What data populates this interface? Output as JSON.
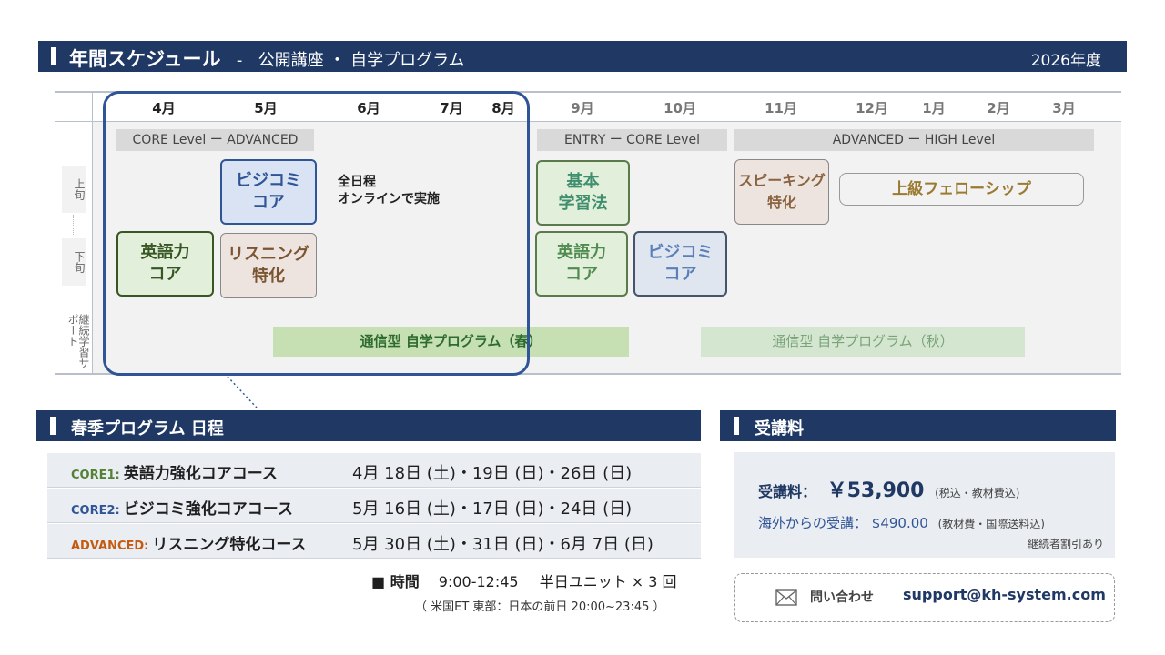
{
  "header": {
    "title": "年間スケジュール",
    "separator": "-",
    "subtitle": "公開講座 ・ 自学プログラム",
    "year": "2026年度"
  },
  "months": [
    "4月",
    "5月",
    "6月",
    "7月",
    "8月",
    "9月",
    "10月",
    "11月",
    "12月",
    "1月",
    "2月",
    "3月"
  ],
  "row_labels": {
    "upper": "上旬",
    "lower": "下旬",
    "support": "継続学習サポート"
  },
  "levels": {
    "spring": "CORE Level ー ADVANCED",
    "fall_entry": "ENTRY ー CORE Level",
    "fall_advanced": "ADVANCED ー HIGH Level"
  },
  "courses": {
    "bizcomi_core": "ビジコミ\nコア",
    "eigo_core": "英語力\nコア",
    "listening": "リスニング\n特化",
    "kihon": "基本\n学習法",
    "eigo_core_fall": "英語力\nコア",
    "bizcomi_core_fall": "ビジコミ\nコア",
    "speaking": "スピーキング\n特化",
    "fellowship": "上級フェローシップ"
  },
  "note_full_day": "全日程\nオンラインで実施",
  "correspondence": {
    "spring": "通信型 自学プログラム（春）",
    "fall": "通信型 自学プログラム（秋）"
  },
  "spring_section": {
    "title": "春季プログラム 日程",
    "rows": [
      {
        "tag": "CORE1:",
        "name": "英語力強化コアコース",
        "dates": "4月 18日 (土)・19日 (日)・26日 (日)",
        "tag_color": "#548235"
      },
      {
        "tag": "CORE2:",
        "name": "ビジコミ強化コアコース",
        "dates": "5月 16日 (土)・17日 (日)・24日 (日)",
        "tag_color": "#2f5597"
      },
      {
        "tag": "ADVANCED:",
        "name": "リスニング特化コース",
        "dates": "5月 30日 (土)・31日 (日)・6月 7日 (日)",
        "tag_color": "#c55a11"
      }
    ],
    "time_label": "■ 時間",
    "time_value": "9:00-12:45",
    "time_unit": "半日ユニット × 3 回",
    "time_note": "（ 米国ET 東部：日本の前日 20:00~23:45 ）"
  },
  "fee_section": {
    "title": "受講料",
    "fee_label": "受講料：",
    "fee_amount": "￥53,900",
    "fee_note": "(税込・教材費込)",
    "overseas_label": "海外からの受講：",
    "overseas_amount": "$490.00",
    "overseas_note": "(教材費・国際送料込)",
    "discount": "継続者割引あり"
  },
  "contact": {
    "label": "問い合わせ",
    "email": "support@kh-system.com",
    "icon": "mail-icon"
  }
}
